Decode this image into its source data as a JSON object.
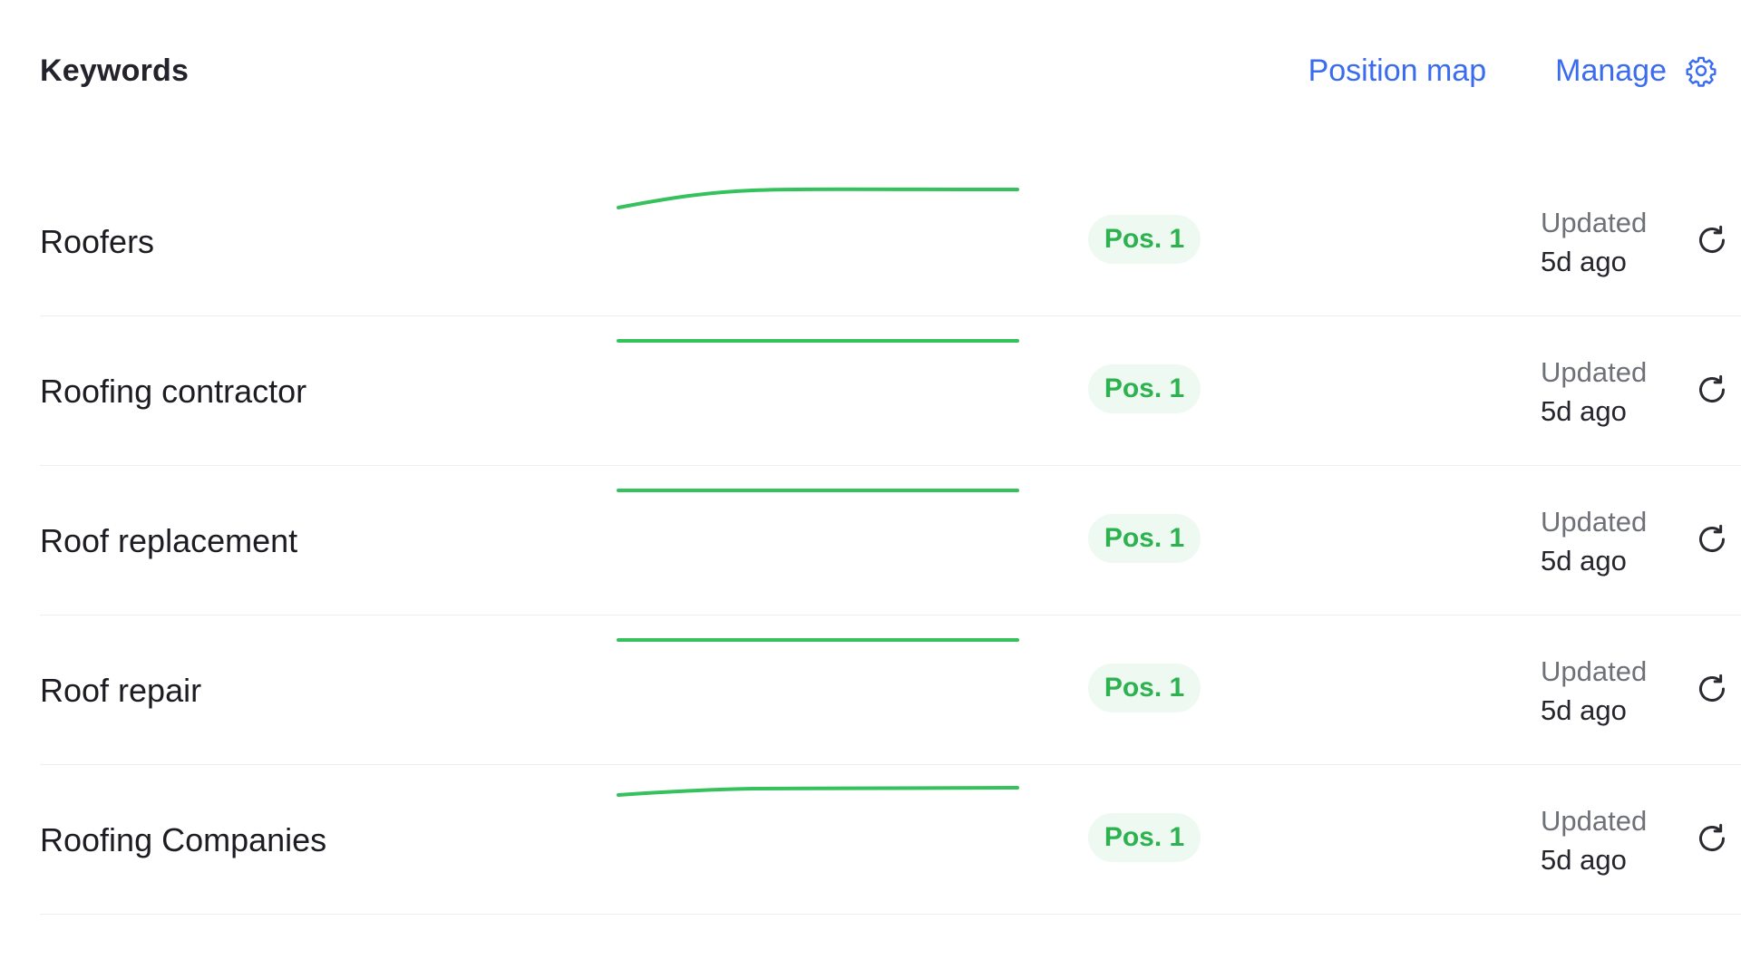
{
  "header": {
    "title": "Keywords",
    "position_map_label": "Position map",
    "manage_label": "Manage",
    "manage_icon": "gear-icon"
  },
  "colors": {
    "accent": "#3b6cf0",
    "positive": "#35c15b",
    "badge_bg": "#eefaf1",
    "badge_text": "#2db24f",
    "muted": "#6f7178"
  },
  "keywords": [
    {
      "keyword": "Roofers",
      "trend": "rising-then-flat",
      "position_label": "Pos. 1",
      "updated_label": "Updated",
      "updated_ago": "5d ago",
      "refresh_icon": "refresh-icon"
    },
    {
      "keyword": "Roofing contractor",
      "trend": "flat",
      "position_label": "Pos. 1",
      "updated_label": "Updated",
      "updated_ago": "5d ago",
      "refresh_icon": "refresh-icon"
    },
    {
      "keyword": "Roof replacement",
      "trend": "flat",
      "position_label": "Pos. 1",
      "updated_label": "Updated",
      "updated_ago": "5d ago",
      "refresh_icon": "refresh-icon"
    },
    {
      "keyword": "Roof repair",
      "trend": "flat",
      "position_label": "Pos. 1",
      "updated_label": "Updated",
      "updated_ago": "5d ago",
      "refresh_icon": "refresh-icon"
    },
    {
      "keyword": "Roofing Companies",
      "trend": "slight-rise-then-flat",
      "position_label": "Pos. 1",
      "updated_label": "Updated",
      "updated_ago": "5d ago",
      "refresh_icon": "refresh-icon"
    }
  ]
}
